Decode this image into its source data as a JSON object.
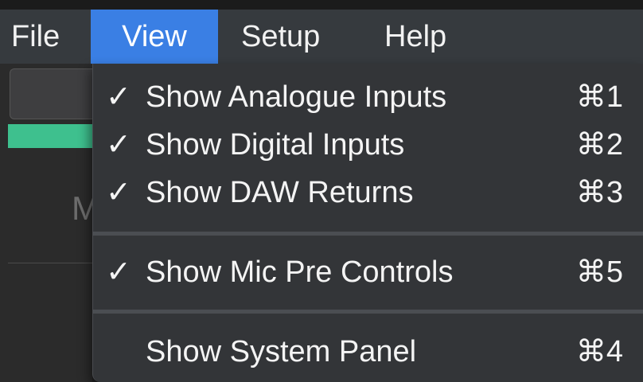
{
  "menubar": {
    "items": [
      {
        "label": "File"
      },
      {
        "label": "View",
        "active": true
      },
      {
        "label": "Setup"
      },
      {
        "label": "Help"
      }
    ]
  },
  "background": {
    "partial_letter": "M"
  },
  "view_menu": {
    "items": [
      {
        "label": "Show Analogue Inputs",
        "checked": true,
        "check": "✓",
        "shortcut": "⌘1"
      },
      {
        "label": "Show Digital Inputs",
        "checked": true,
        "check": "✓",
        "shortcut": "⌘2"
      },
      {
        "label": "Show DAW Returns",
        "checked": true,
        "check": "✓",
        "shortcut": "⌘3"
      },
      {
        "label": "Show Mic Pre Controls",
        "checked": true,
        "check": "✓",
        "shortcut": "⌘5"
      },
      {
        "label": "Show System Panel",
        "checked": false,
        "check": "",
        "shortcut": "⌘4"
      }
    ]
  },
  "colors": {
    "menubar_bg": "#363a3e",
    "menu_highlight": "#3a7fe4",
    "dropdown_bg": "#333538",
    "meter_green": "#3ec08e"
  }
}
